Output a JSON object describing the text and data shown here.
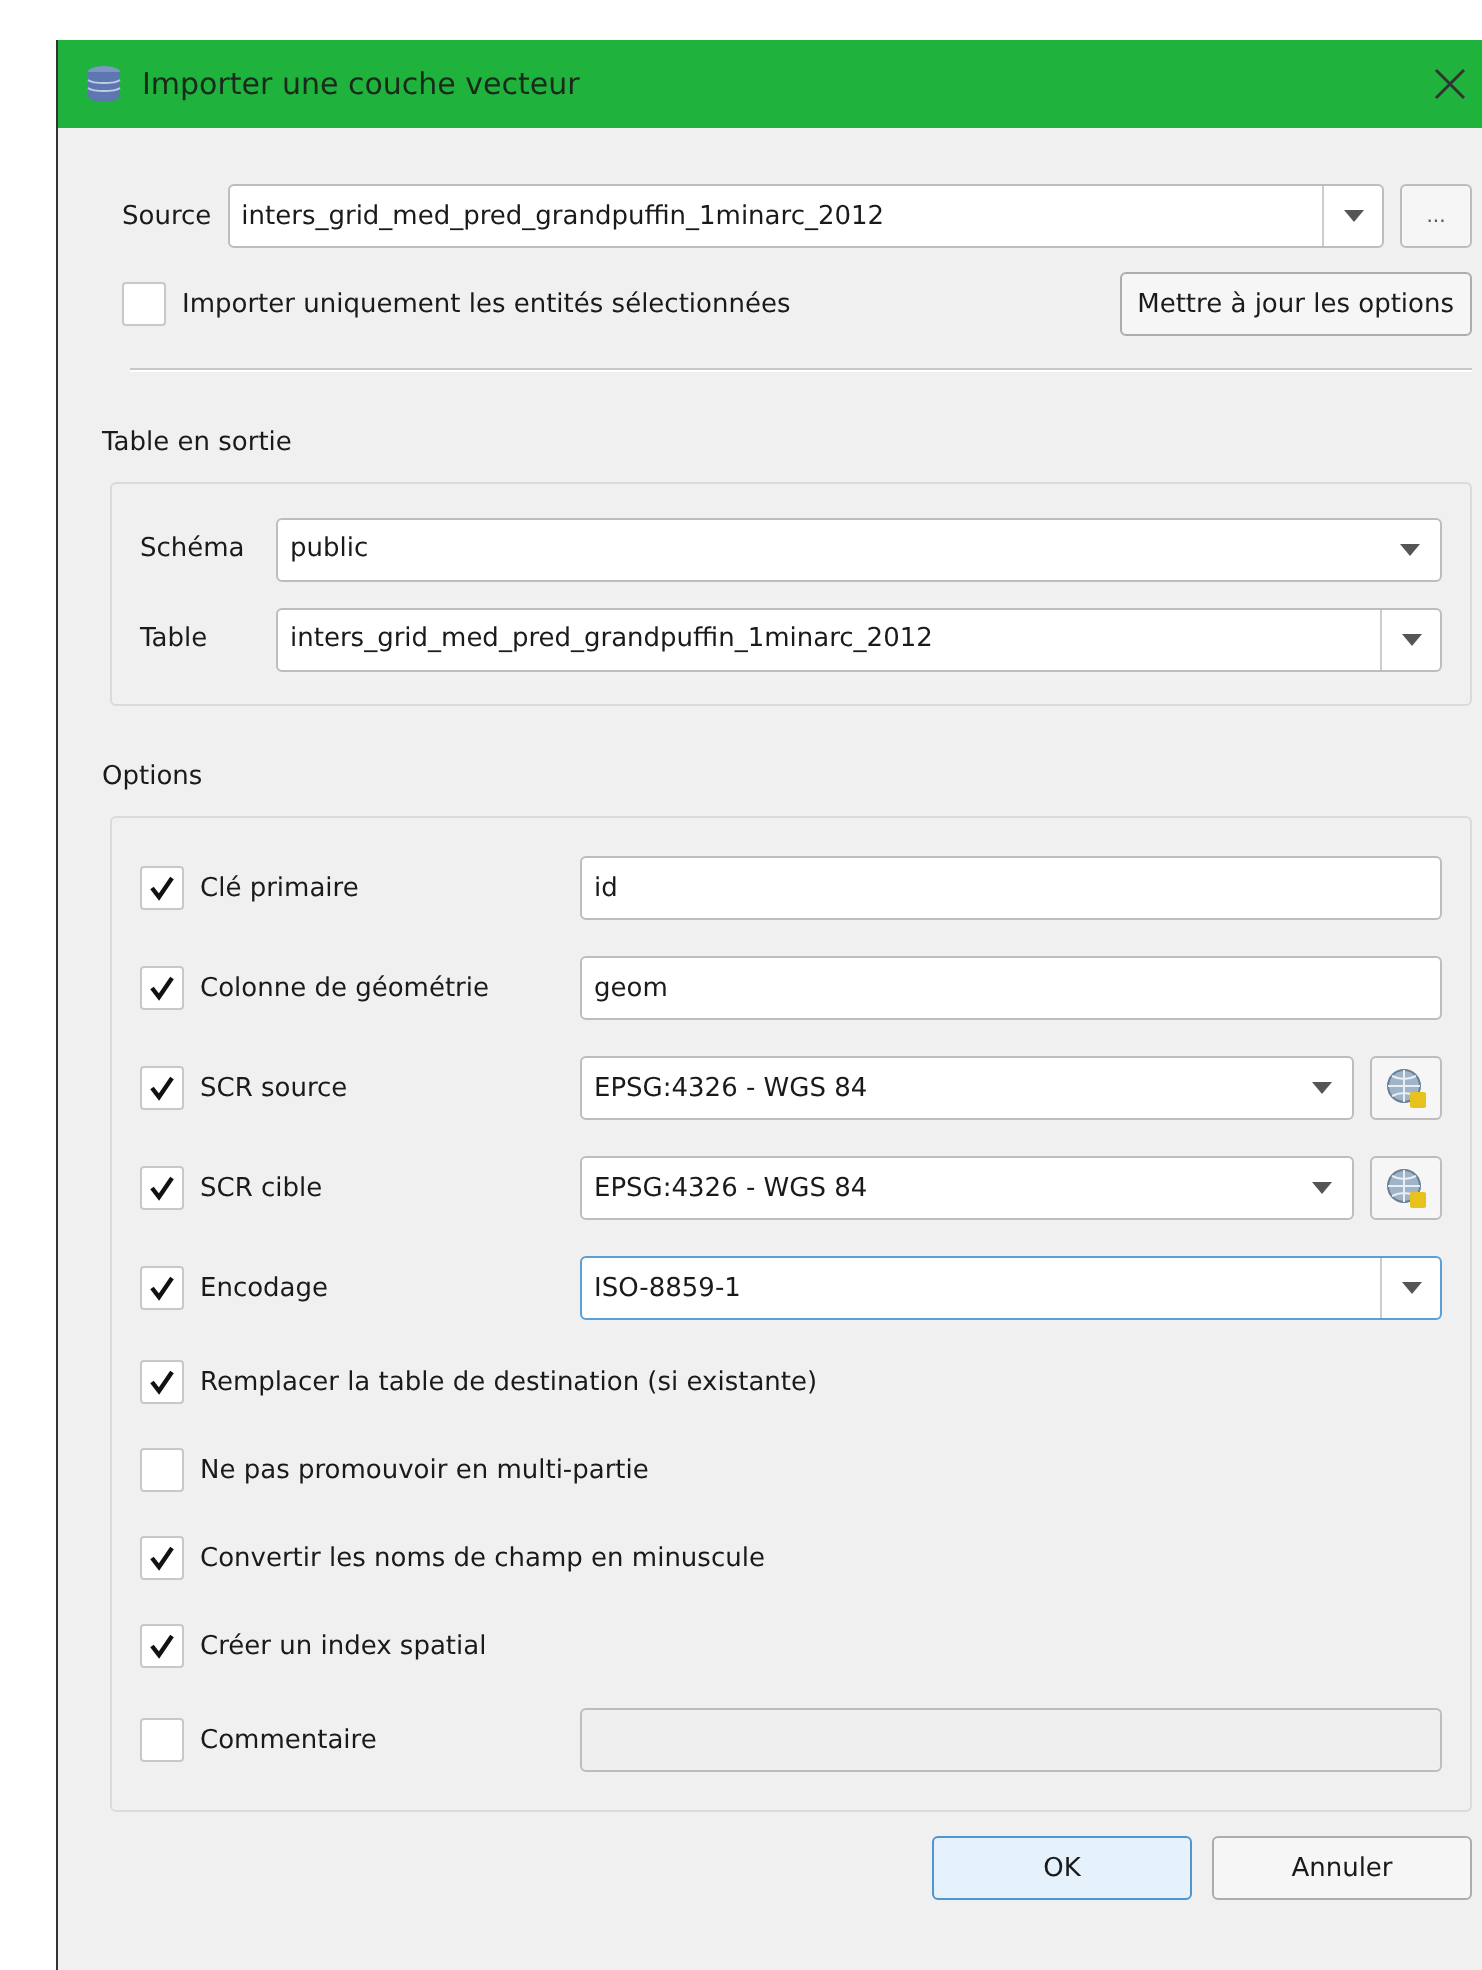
{
  "window": {
    "title": "Importer une couche vecteur"
  },
  "source": {
    "label": "Source",
    "value": "inters_grid_med_pred_grandpuffin_1minarc_2012",
    "browse": "..."
  },
  "only_selected": {
    "label": "Importer uniquement les entités sélectionnées",
    "checked": false
  },
  "update_button": "Mettre à jour les options",
  "output": {
    "title": "Table en sortie",
    "rows": [
      {
        "label": "Schéma",
        "value": "public",
        "kind": "combo"
      },
      {
        "label": "Table",
        "value": "inters_grid_med_pred_grandpuffin_1minarc_2012",
        "kind": "editable"
      }
    ]
  },
  "options": {
    "title": "Options",
    "items": [
      {
        "kind": "field",
        "label": "Clé primaire",
        "checked": true,
        "value": "id"
      },
      {
        "kind": "field",
        "label": "Colonne de géométrie",
        "checked": true,
        "value": "geom"
      },
      {
        "kind": "crs",
        "label": "SCR source",
        "checked": true,
        "value": "EPSG:4326 - WGS 84"
      },
      {
        "kind": "crs",
        "label": "SCR cible",
        "checked": true,
        "value": "EPSG:4326 - WGS 84"
      },
      {
        "kind": "combo",
        "label": "Encodage",
        "checked": true,
        "value": "ISO-8859-1"
      },
      {
        "kind": "check",
        "label": "Remplacer la table de destination (si existante)",
        "checked": true
      },
      {
        "kind": "check",
        "label": "Ne pas promouvoir en multi-partie",
        "checked": false
      },
      {
        "kind": "check",
        "label": "Convertir les noms de champ en minuscule",
        "checked": true
      },
      {
        "kind": "check",
        "label": "Créer un index spatial",
        "checked": true
      },
      {
        "kind": "field",
        "label": "Commentaire",
        "checked": false
      }
    ]
  },
  "buttons": [
    {
      "label": "OK",
      "kind": "default"
    },
    {
      "label": "Annuler",
      "kind": "normal"
    }
  ]
}
